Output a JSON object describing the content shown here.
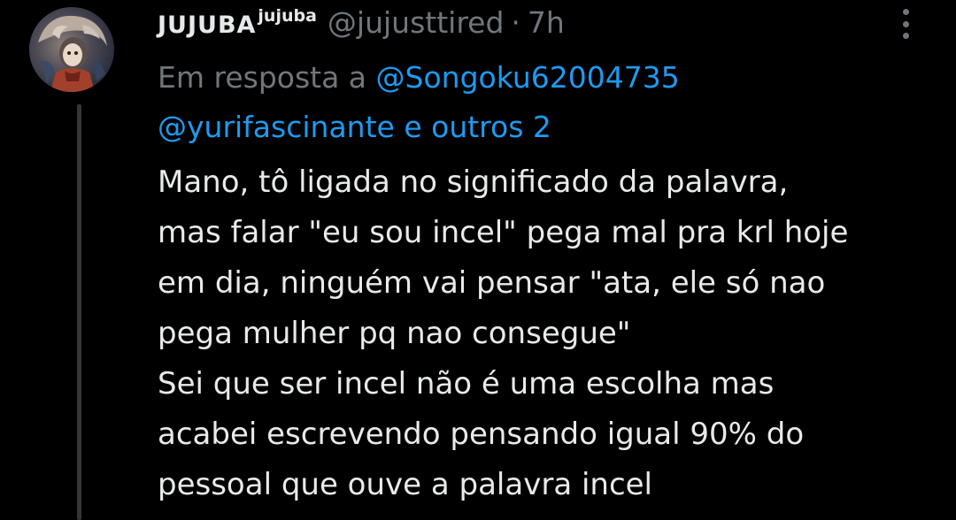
{
  "tweet": {
    "display_name": "JUJUBA",
    "display_name_sup": "jujuba",
    "handle": "@jujusttired",
    "separator": "·",
    "time": "7h",
    "reply_prefix": "Em resposta a",
    "reply_mention_1": "@Songoku62004735",
    "reply_mention_2": "@yurifascinante",
    "reply_conjunction": "e",
    "reply_others": "outros 2",
    "body_lines": [
      "Mano, tô ligada no significado da palavra,",
      "mas falar \"eu sou incel\" pega mal pra krl hoje",
      "em dia, ninguém vai pensar \"ata, ele só nao",
      "pega mulher pq nao consegue\"",
      "Sei que ser incel não é uma escolha mas",
      "acabei escrevendo pensando igual 90% do",
      "pessoal que ouve a palavra incel"
    ]
  },
  "icons": {
    "avatar": "avatar-image",
    "more": "more-vertical-icon"
  },
  "colors": {
    "background": "#000000",
    "text": "#e7e9ea",
    "secondary": "#71767b",
    "link": "#1d9bf0",
    "thread_line": "#333639"
  }
}
